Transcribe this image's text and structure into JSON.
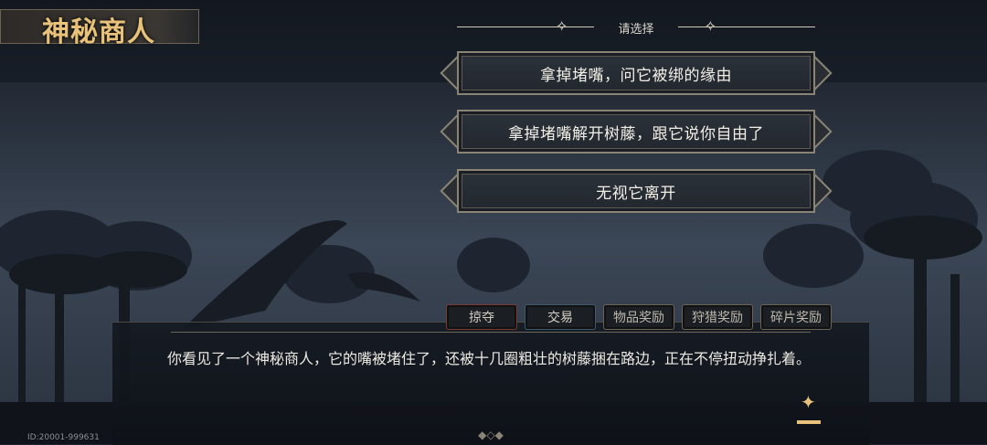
{
  "header": {
    "title": "神秘商人"
  },
  "choice": {
    "heading": "请选择",
    "options": [
      {
        "label": "拿掉堵嘴，问它被绑的缘由"
      },
      {
        "label": "拿掉堵嘴解开树藤，跟它说你自由了"
      },
      {
        "label": "无视它离开"
      }
    ]
  },
  "tabs": [
    {
      "label": "掠夺"
    },
    {
      "label": "交易"
    },
    {
      "label": "物品奖励"
    },
    {
      "label": "狩猎奖励"
    },
    {
      "label": "碎片奖励"
    }
  ],
  "dialog": {
    "text": "你看见了一个神秘商人，它的嘴被堵住了，还被十几圈粗壮的树藤捆在路边，正在不停扭动挣扎着。"
  },
  "footer": {
    "id": "ID:20001-999631"
  },
  "colors": {
    "title": "#e8c27a",
    "accent": "#e8c27a",
    "frame": "#8a8474"
  }
}
